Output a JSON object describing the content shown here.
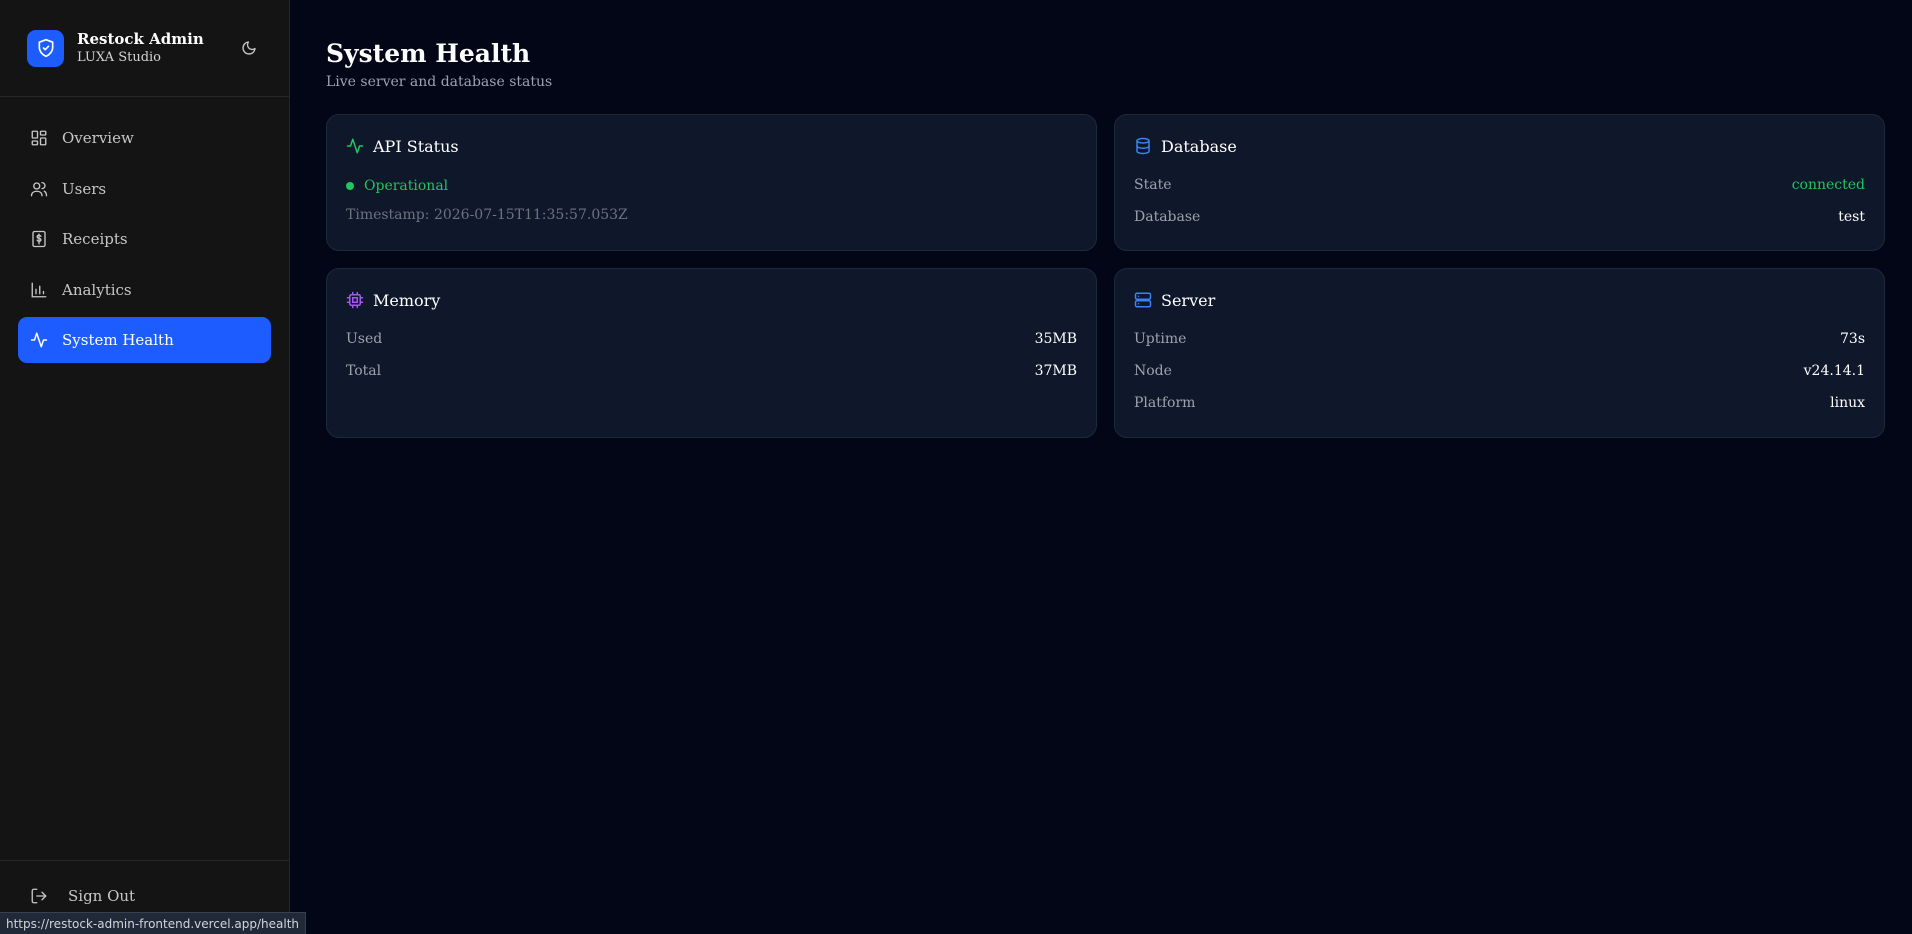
{
  "brand": {
    "title": "Restock Admin",
    "subtitle": "LUXA Studio"
  },
  "nav": {
    "items": [
      {
        "label": "Overview",
        "icon": "dashboard-icon"
      },
      {
        "label": "Users",
        "icon": "users-icon"
      },
      {
        "label": "Receipts",
        "icon": "receipt-icon"
      },
      {
        "label": "Analytics",
        "icon": "bar-chart-icon"
      },
      {
        "label": "System Health",
        "icon": "activity-icon",
        "active": true
      }
    ],
    "sign_out": "Sign Out"
  },
  "status_bar": {
    "url": "https://restock-admin-frontend.vercel.app/health"
  },
  "page": {
    "title": "System Health",
    "subtitle": "Live server and database status"
  },
  "cards": {
    "api": {
      "title": "API Status",
      "status": "Operational",
      "timestamp": "Timestamp: 2026-07-15T11:35:57.053Z"
    },
    "database": {
      "title": "Database",
      "rows": [
        {
          "key": "State",
          "value": "connected"
        },
        {
          "key": "Database",
          "value": "test"
        }
      ]
    },
    "memory": {
      "title": "Memory",
      "rows": [
        {
          "key": "Used",
          "value": "35MB"
        },
        {
          "key": "Total",
          "value": "37MB"
        }
      ]
    },
    "server": {
      "title": "Server",
      "rows": [
        {
          "key": "Uptime",
          "value": "73s"
        },
        {
          "key": "Node",
          "value": "v24.14.1"
        },
        {
          "key": "Platform",
          "value": "linux"
        }
      ]
    }
  },
  "colors": {
    "accent": "#1d5cff",
    "success": "#22c55e",
    "memory_icon": "#a855f7",
    "db_icon": "#3b82f6",
    "background": "#020617",
    "card": "#0f172a",
    "sidebar": "#141414"
  }
}
